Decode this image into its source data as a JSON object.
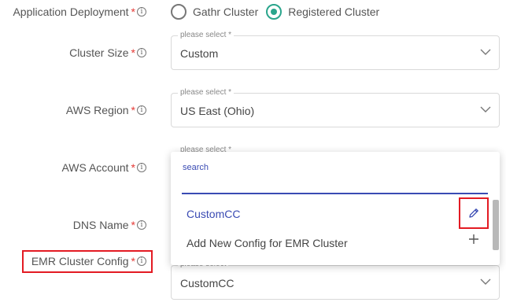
{
  "app_deploy": {
    "label": "Application Deployment",
    "options": [
      "Gathr Cluster",
      "Registered Cluster"
    ],
    "selected": "Registered Cluster"
  },
  "fields": {
    "cluster_size": {
      "label": "Cluster Size",
      "placeholder": "please select *",
      "value": "Custom"
    },
    "aws_region": {
      "label": "AWS Region",
      "placeholder": "please select *",
      "value": "US East (Ohio)"
    },
    "aws_account": {
      "label": "AWS Account",
      "placeholder": "please select *"
    },
    "dns_name": {
      "label": "DNS Name"
    },
    "emr_config": {
      "label": "EMR Cluster Config",
      "placeholder": "please select",
      "value": "CustomCC"
    }
  },
  "required_mark": "*",
  "info_glyph": "i",
  "dropdown": {
    "search_label": "search",
    "items": [
      "CustomCC",
      "Add New Config for EMR Cluster"
    ]
  },
  "colors": {
    "accent": "#3a4bb3",
    "radio_checked": "#2aa58c",
    "required": "#e53935",
    "highlight": "#e31b23"
  },
  "icons": {
    "edit": "pencil-icon",
    "add": "plus-icon",
    "expand": "chevron-down-icon",
    "info": "info-icon"
  }
}
